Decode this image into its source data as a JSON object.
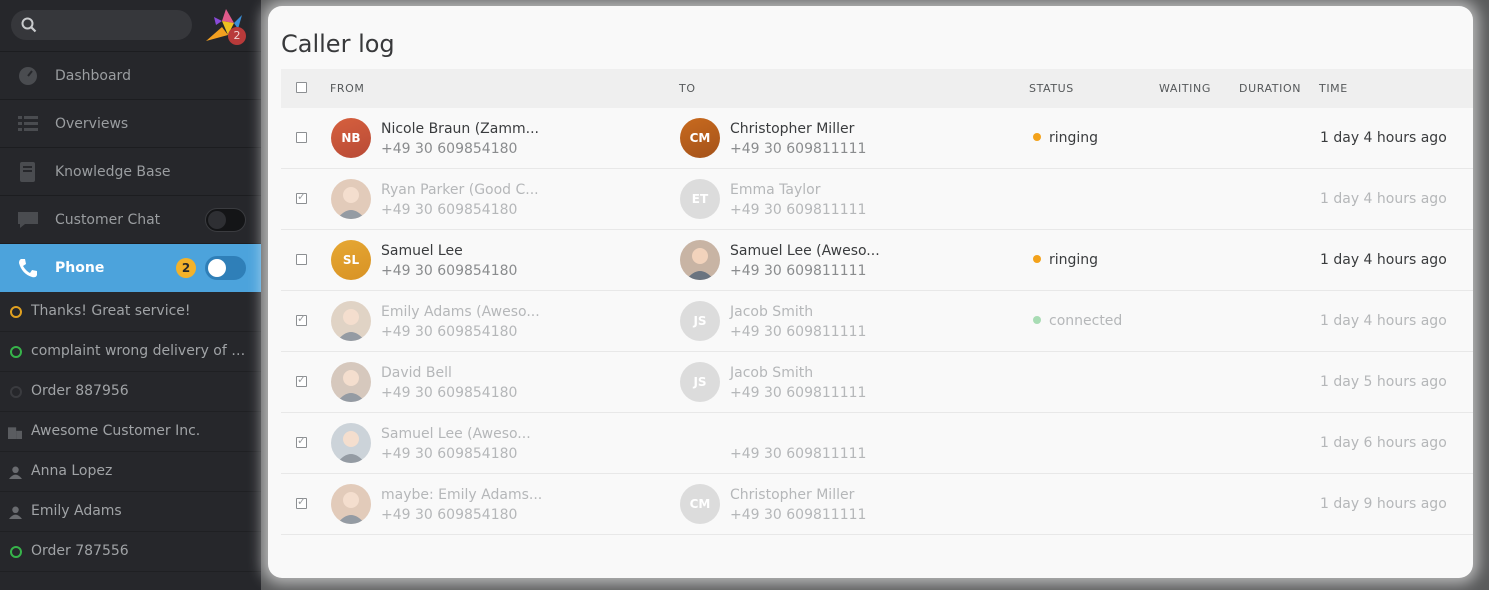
{
  "sidebar": {
    "logo_badge": "2",
    "nav": [
      {
        "label": "Dashboard",
        "icon": "dashboard-icon"
      },
      {
        "label": "Overviews",
        "icon": "list-icon"
      },
      {
        "label": "Knowledge Base",
        "icon": "book-icon"
      },
      {
        "label": "Customer Chat",
        "icon": "chat-icon"
      },
      {
        "label": "Phone",
        "icon": "phone-icon",
        "badge": "2"
      }
    ],
    "tasks": [
      {
        "label": "Thanks! Great service!",
        "icon": "ticket-open-icon"
      },
      {
        "label": "complaint wrong delivery of ord...",
        "icon": "ticket-new-icon"
      },
      {
        "label": "Order 887956",
        "icon": "ticket-closed-icon"
      },
      {
        "label": "Awesome Customer Inc.",
        "icon": "organization-icon"
      },
      {
        "label": "Anna Lopez",
        "icon": "user-icon"
      },
      {
        "label": "Emily Adams",
        "icon": "user-icon"
      },
      {
        "label": "Order 787556",
        "icon": "ticket-new-icon"
      }
    ]
  },
  "main": {
    "title": "Caller log",
    "columns": {
      "from": "FROM",
      "to": "TO",
      "status": "STATUS",
      "waiting": "WAITING",
      "duration": "DURATION",
      "time": "TIME"
    },
    "rows": [
      {
        "checked": false,
        "from_initials": "NB",
        "from_name": "Nicole Braun (Zamm...",
        "from_phone": "+49 30 609854180",
        "to_initials": "CM",
        "to_name": "Christopher Miller",
        "to_phone": "+49 30 609811111",
        "status": "ringing",
        "time": "1 day 4 hours ago"
      },
      {
        "checked": true,
        "from_initials": "",
        "from_name": "Ryan Parker (Good C...",
        "from_phone": "+49 30 609854180",
        "to_initials": "ET",
        "to_name": "Emma Taylor",
        "to_phone": "+49 30 609811111",
        "status": "",
        "time": "1 day 4 hours ago"
      },
      {
        "checked": false,
        "from_initials": "SL",
        "from_name": "Samuel Lee",
        "from_phone": "+49 30 609854180",
        "to_initials": "",
        "to_name": "Samuel Lee (Aweso...",
        "to_phone": "+49 30 609811111",
        "status": "ringing",
        "time": "1 day 4 hours ago"
      },
      {
        "checked": true,
        "from_initials": "",
        "from_name": "Emily Adams (Aweso...",
        "from_phone": "+49 30 609854180",
        "to_initials": "JS",
        "to_name": "Jacob Smith",
        "to_phone": "+49 30 609811111",
        "status": "connected",
        "time": "1 day 4 hours ago"
      },
      {
        "checked": true,
        "from_initials": "",
        "from_name": "David Bell",
        "from_phone": "+49 30 609854180",
        "to_initials": "JS",
        "to_name": "Jacob Smith",
        "to_phone": "+49 30 609811111",
        "status": "",
        "time": "1 day 5 hours ago"
      },
      {
        "checked": true,
        "from_initials": "",
        "from_name": "Samuel Lee (Aweso...",
        "from_phone": "+49 30 609854180",
        "to_initials": "",
        "to_name": "",
        "to_phone": "+49 30 609811111",
        "status": "",
        "time": "1 day 6 hours ago"
      },
      {
        "checked": true,
        "from_initials": "",
        "from_name": "maybe: Emily Adams...",
        "from_phone": "+49 30 609854180",
        "to_initials": "CM",
        "to_name": "Christopher Miller",
        "to_phone": "+49 30 609811111",
        "status": "",
        "time": "1 day 9 hours ago"
      }
    ]
  },
  "colors": {
    "sidebar_bg": "#26272b",
    "active_nav": "#4ca3dc",
    "badge": "#f3b22a",
    "ringing": "#f3a21b",
    "connected": "#a8dcb4"
  }
}
